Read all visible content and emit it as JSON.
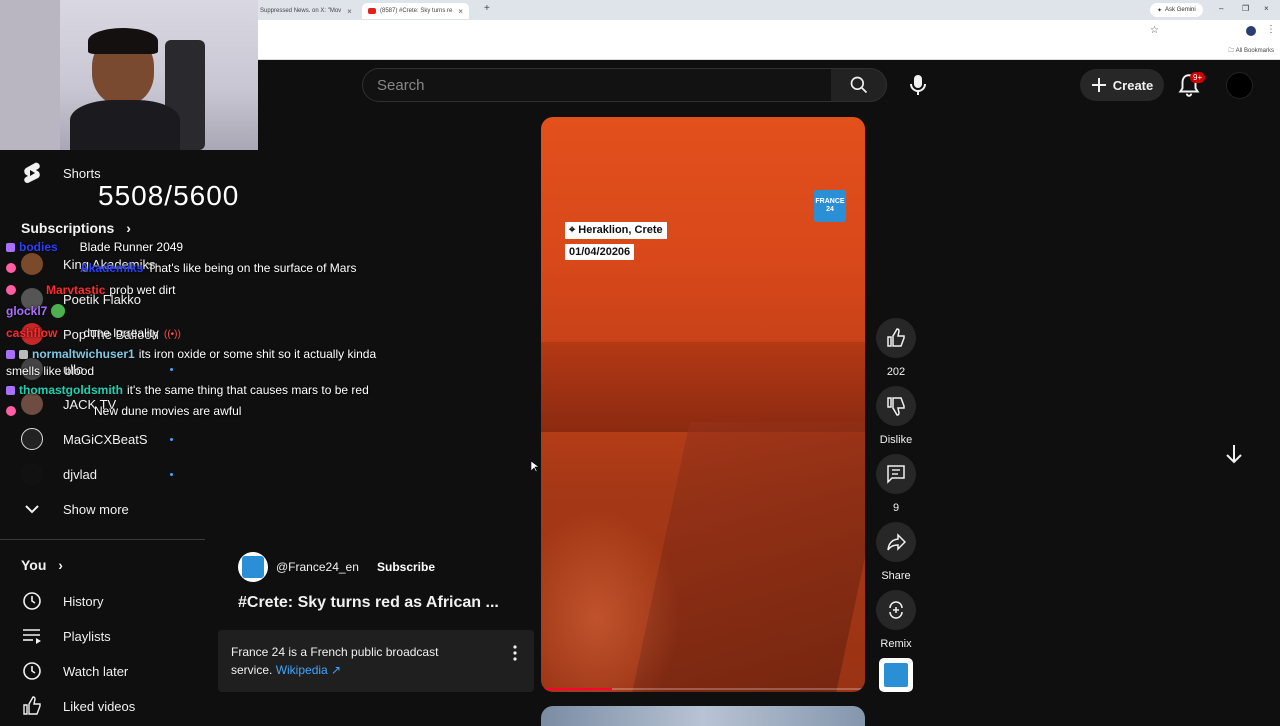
{
  "browser": {
    "tabs": [
      {
        "title": "Suppressed News. on X: \"Mov",
        "active": false
      },
      {
        "title": "(8587) #Crete: Sky turns re",
        "active": true
      }
    ],
    "gemini_label": "Ask Gemini",
    "all_bookmarks": "All Bookmarks"
  },
  "header": {
    "search_placeholder": "Search",
    "create_label": "Create",
    "notification_count": "9+"
  },
  "overlay": {
    "counter": "5508/5600",
    "chat": [
      {
        "user": "bodies",
        "msg": "Blade Runner 2049",
        "user_color": "#2a3fff"
      },
      {
        "user": "Akademiks",
        "msg": "That's like being on the surface of Mars",
        "user_color": "#2a3fff"
      },
      {
        "user": "Marvtastic",
        "msg": "prob wet dirt",
        "user_color": "#ff2a2a"
      },
      {
        "user": "glockl7",
        "msg": "",
        "user_color": "#a970ff"
      },
      {
        "user": "cashflow",
        "msg": "dune lorreality",
        "user_color": "#ff2a2a"
      },
      {
        "user": "normaltwichuser1",
        "msg": "its iron oxide or some shit so it actually kinda",
        "user_color": "#7ec8e3"
      },
      {
        "user": "",
        "msg": "smells like blood",
        "user_color": "#fff"
      },
      {
        "user": "thomastgoldsmith",
        "msg": "it's the same thing that causes mars to be red",
        "user_color": "#1fd1b0"
      },
      {
        "user": "",
        "msg": "New dune movies are awful",
        "user_color": "#2a3fff"
      }
    ]
  },
  "sidebar": {
    "shorts_label": "Shorts",
    "subscriptions_title": "Subscriptions",
    "subscriptions": [
      {
        "name": "King Akademiks"
      },
      {
        "name": "Poetik Flakko"
      },
      {
        "name": "Pop The Balloon"
      },
      {
        "name": "ullo"
      },
      {
        "name": "JACK TV"
      },
      {
        "name": "MaGiCXBeatS"
      },
      {
        "name": "djvlad"
      }
    ],
    "show_more": "Show more",
    "you_title": "You",
    "you_items": [
      {
        "label": "History",
        "icon": "history-icon"
      },
      {
        "label": "Playlists",
        "icon": "playlists-icon"
      },
      {
        "label": "Watch later",
        "icon": "watch-later-icon"
      },
      {
        "label": "Liked videos",
        "icon": "liked-videos-icon"
      }
    ]
  },
  "short": {
    "location": "Heraklion, Crete",
    "date": "01/04/20206",
    "logo_text": "FRANCE 24",
    "progress": 0.22,
    "likes": "202",
    "dislike_label": "Dislike",
    "comments": "9",
    "share_label": "Share",
    "remix_label": "Remix"
  },
  "channel": {
    "handle": "@France24_en",
    "subscribe_label": "Subscribe",
    "title": "#Crete: Sky turns red as African ...",
    "info_text": "France 24 is a French public broadcast service.",
    "info_link": "Wikipedia ↗"
  }
}
